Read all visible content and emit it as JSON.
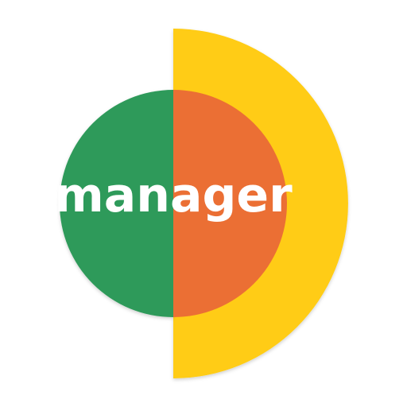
{
  "logo": {
    "wordmark": "manager",
    "colors": {
      "background": "#ffffff",
      "left_half": "#2f9a5a",
      "right_inner": "#eb6f34",
      "right_outer": "#ffcc12",
      "wordmark": "#ffffff"
    }
  }
}
